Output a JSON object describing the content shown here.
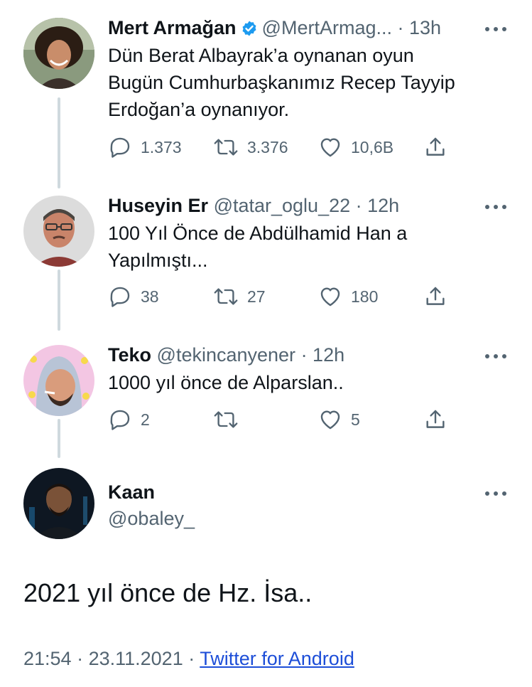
{
  "tweets": [
    {
      "name": "Mert Armağan",
      "handle": "@MertArmag...",
      "time": "· 13h",
      "lines": [
        "Dün Berat Albayrak’a oynanan oyun",
        "Bugün Cumhurbaşkanımız Recep Tayyip",
        "Erdoğan’a oynanıyor."
      ],
      "replies": "1.373",
      "retweets": "3.376",
      "likes": "10,6B"
    },
    {
      "name": "Huseyin Er",
      "handle": "@tatar_oglu_22",
      "time": "· 12h",
      "lines": [
        "100 Yıl Önce de Abdülhamid Han a",
        "Yapılmıştı..."
      ],
      "replies": "38",
      "retweets": "27",
      "likes": "180"
    },
    {
      "name": "Teko",
      "handle": "@tekincanyener",
      "time": "· 12h",
      "lines": [
        "1000 yıl önce  de Alparslan.."
      ],
      "replies": "2",
      "retweets": "",
      "likes": "5"
    }
  ],
  "main_tweet": {
    "name": "Kaan",
    "handle": "@obaley_",
    "text": "2021 yıl önce de Hz. İsa..",
    "time": "21:54",
    "date": "23.11.2021",
    "source": "Twitter for Android"
  },
  "colors": {
    "verified_badge": "#1d9bf0",
    "secondary_text": "#536471",
    "link": "#1d4ed8"
  }
}
